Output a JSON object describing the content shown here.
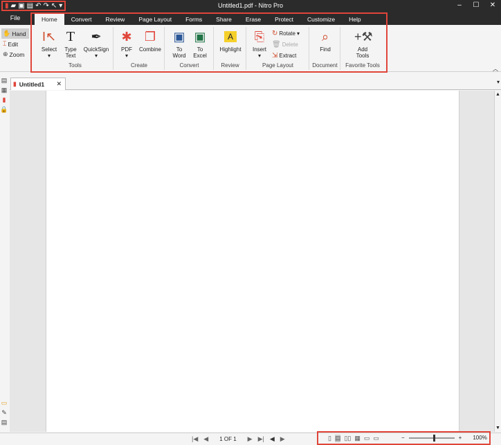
{
  "window": {
    "title": "Untitled1.pdf - Nitro Pro",
    "controls": [
      "–",
      "☐",
      "✕"
    ]
  },
  "quick_access": {
    "icons": [
      "pdf-logo-icon",
      "open-folder-icon",
      "save-icon",
      "print-icon",
      "undo-icon",
      "redo-icon",
      "cursor-icon",
      "customize-icon"
    ]
  },
  "file_tab": "File",
  "ribbon_tabs": [
    "Home",
    "Convert",
    "Review",
    "Page Layout",
    "Forms",
    "Share",
    "Erase",
    "Protect",
    "Customize",
    "Help"
  ],
  "side_tools": [
    "Hand",
    "Edit",
    "Zoom"
  ],
  "groups": {
    "tools": {
      "label": "Tools",
      "select": "Select",
      "type_text_1": "Type",
      "type_text_2": "Text",
      "quicksign": "QuickSign"
    },
    "create": {
      "label": "Create",
      "pdf": "PDF",
      "combine": "Combine"
    },
    "convert": {
      "label": "Convert",
      "to_word_1": "To",
      "to_word_2": "Word",
      "to_excel_1": "To",
      "to_excel_2": "Excel"
    },
    "review": {
      "label": "Review",
      "highlight": "Highlight"
    },
    "page_layout": {
      "label": "Page Layout",
      "insert": "Insert",
      "rotate": "Rotate",
      "delete": "Delete",
      "extract": "Extract"
    },
    "document": {
      "label": "Document",
      "find": "Find"
    },
    "favorite": {
      "label": "Favorite Tools",
      "add_1": "Add",
      "add_2": "Tools"
    }
  },
  "document_tab": {
    "name": "Untitled1",
    "close": "✕"
  },
  "status": {
    "page": "1 OF 1",
    "zoom": "100%",
    "zoom_minus": "−",
    "zoom_plus": "+",
    "zoom_value": 100
  },
  "colors": {
    "highlight_border": "#e0453a",
    "chrome": "#2b2b2b",
    "accent": "#d04a2a"
  }
}
